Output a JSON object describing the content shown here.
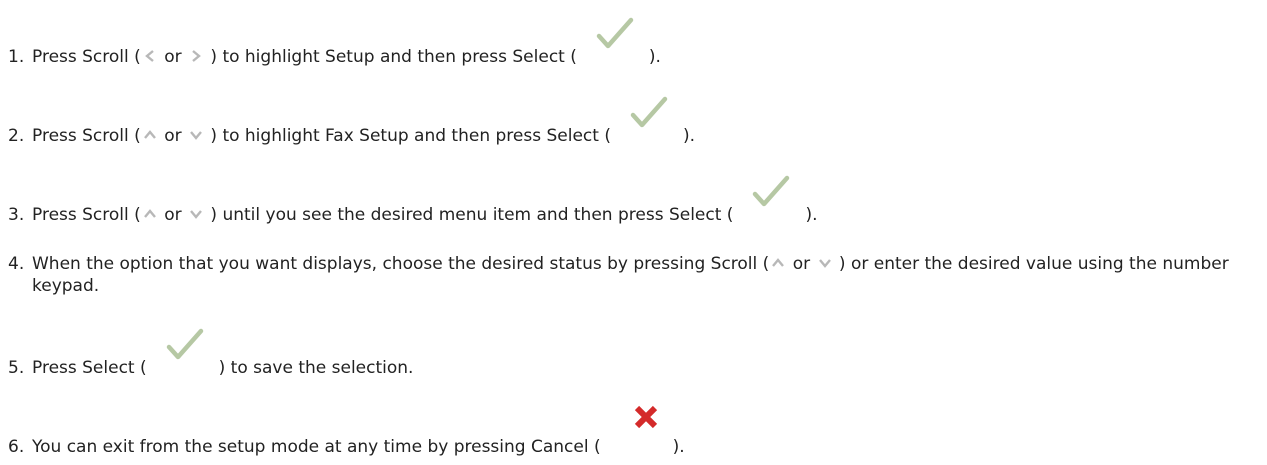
{
  "steps": [
    {
      "number": "1.",
      "t0": "Press Scroll (",
      "icon_a": "scroll-left-icon",
      "t1": " or ",
      "icon_b": "scroll-right-icon",
      "t2": " ) to highlight Setup and then press Select (",
      "icon_c": "select-check-icon",
      "t3": ")."
    },
    {
      "number": "2.",
      "t0": "Press Scroll (",
      "icon_a": "scroll-up-icon",
      "t1": " or ",
      "icon_b": "scroll-down-icon",
      "t2": " ) to highlight Fax Setup and then press Select (",
      "icon_c": "select-check-icon",
      "t3": ")."
    },
    {
      "number": "3.",
      "t0": "Press Scroll (",
      "icon_a": "scroll-up-icon",
      "t1": " or ",
      "icon_b": "scroll-down-icon",
      "t2": " ) until you see the desired menu item and then press Select (",
      "icon_c": "select-check-icon",
      "t3": ")."
    },
    {
      "number": "4.",
      "t0": "When the option that you want displays, choose the desired status by pressing Scroll (",
      "icon_a": "scroll-up-icon",
      "t1": " or ",
      "icon_b": "scroll-down-icon",
      "t2": " ) or enter the desired value using the number keypad."
    },
    {
      "number": "5.",
      "t0": "Press Select (",
      "icon_c": "select-check-icon",
      "t1": ") to save the selection."
    },
    {
      "number": "6.",
      "t0": "You can exit from the setup mode at any time by pressing Cancel (",
      "icon_c": "cancel-x-icon",
      "t1": ")."
    }
  ],
  "colors": {
    "text": "#222222",
    "chevron": "#b8b8b8",
    "check": "#b6c8a4",
    "cancel": "#d42a2a"
  }
}
